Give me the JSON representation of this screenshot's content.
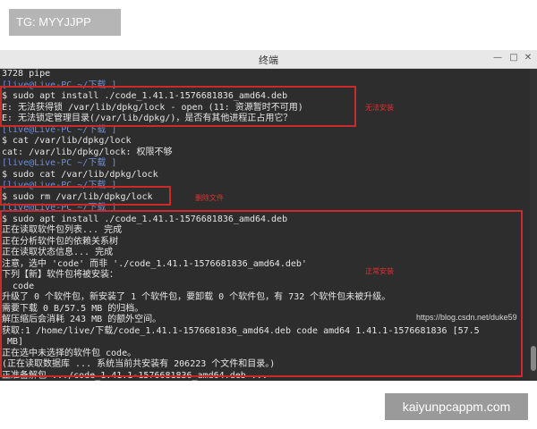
{
  "watermarks": {
    "top": "TG: MYYJJPP",
    "bottom": "kaiyunpcappm.com"
  },
  "window": {
    "title": "终端",
    "minimize_icon": "minimize-icon",
    "maximize_icon": "maximize-icon",
    "close_icon": "close-icon"
  },
  "terminal": {
    "lines": [
      "3728 pipe",
      "[live@Live-PC ~/下载 ]",
      "$ sudo apt install ./code_1.41.1-1576681836_amd64.deb",
      "E: 无法获得锁 /var/lib/dpkg/lock - open (11: 资源暂时不可用)",
      "E: 无法锁定管理目录(/var/lib/dpkg/)，是否有其他进程正占用它？",
      "[live@Live-PC ~/下载 ]",
      "$ cat /var/lib/dpkg/lock",
      "cat: /var/lib/dpkg/lock: 权限不够",
      "[live@Live-PC ~/下载 ]",
      "$ sudo cat /var/lib/dpkg/lock",
      "[live@Live-PC ~/下载 ]",
      "$ sudo rm /var/lib/dpkg/lock",
      "[live@Live-PC ~/下载 ]",
      "$ sudo apt install ./code_1.41.1-1576681836_amd64.deb",
      "正在读取软件包列表... 完成",
      "正在分析软件包的依赖关系树",
      "正在读取状态信息... 完成",
      "注意，选中 'code' 而非 './code_1.41.1-1576681836_amd64.deb'",
      "下列【新】软件包将被安装：",
      "  code",
      "升级了 0 个软件包，新安装了 1 个软件包，要卸载 0 个软件包，有 732 个软件包未被升级。",
      "需要下载 0 B/57.5 MB 的归档。",
      "解压缩后会消耗 243 MB 的额外空间。",
      "获取:1 /home/live/下载/code_1.41.1-1576681836_amd64.deb code amd64 1.41.1-1576681836 [57.5",
      " MB]",
      "正在选中未选择的软件包 code。",
      "(正在读取数据库 ... 系统当前共安装有 206223 个文件和目录。)",
      "正准备解包 .../code_1.41.1-1576681836_amd64.deb ..."
    ],
    "line_styles": [
      "white",
      "prompt",
      "white",
      "white",
      "white",
      "prompt",
      "white",
      "white",
      "prompt",
      "white",
      "prompt",
      "white",
      "prompt",
      "white",
      "white",
      "white",
      "white",
      "white",
      "white",
      "white",
      "white",
      "white",
      "white",
      "white",
      "white",
      "white",
      "white",
      "white"
    ]
  },
  "annotations": {
    "error_label": "无法安装",
    "delete_label": "删除文件",
    "success_label": "正常安装"
  },
  "csdn_watermark": "https://blog.csdn.net/duke59"
}
